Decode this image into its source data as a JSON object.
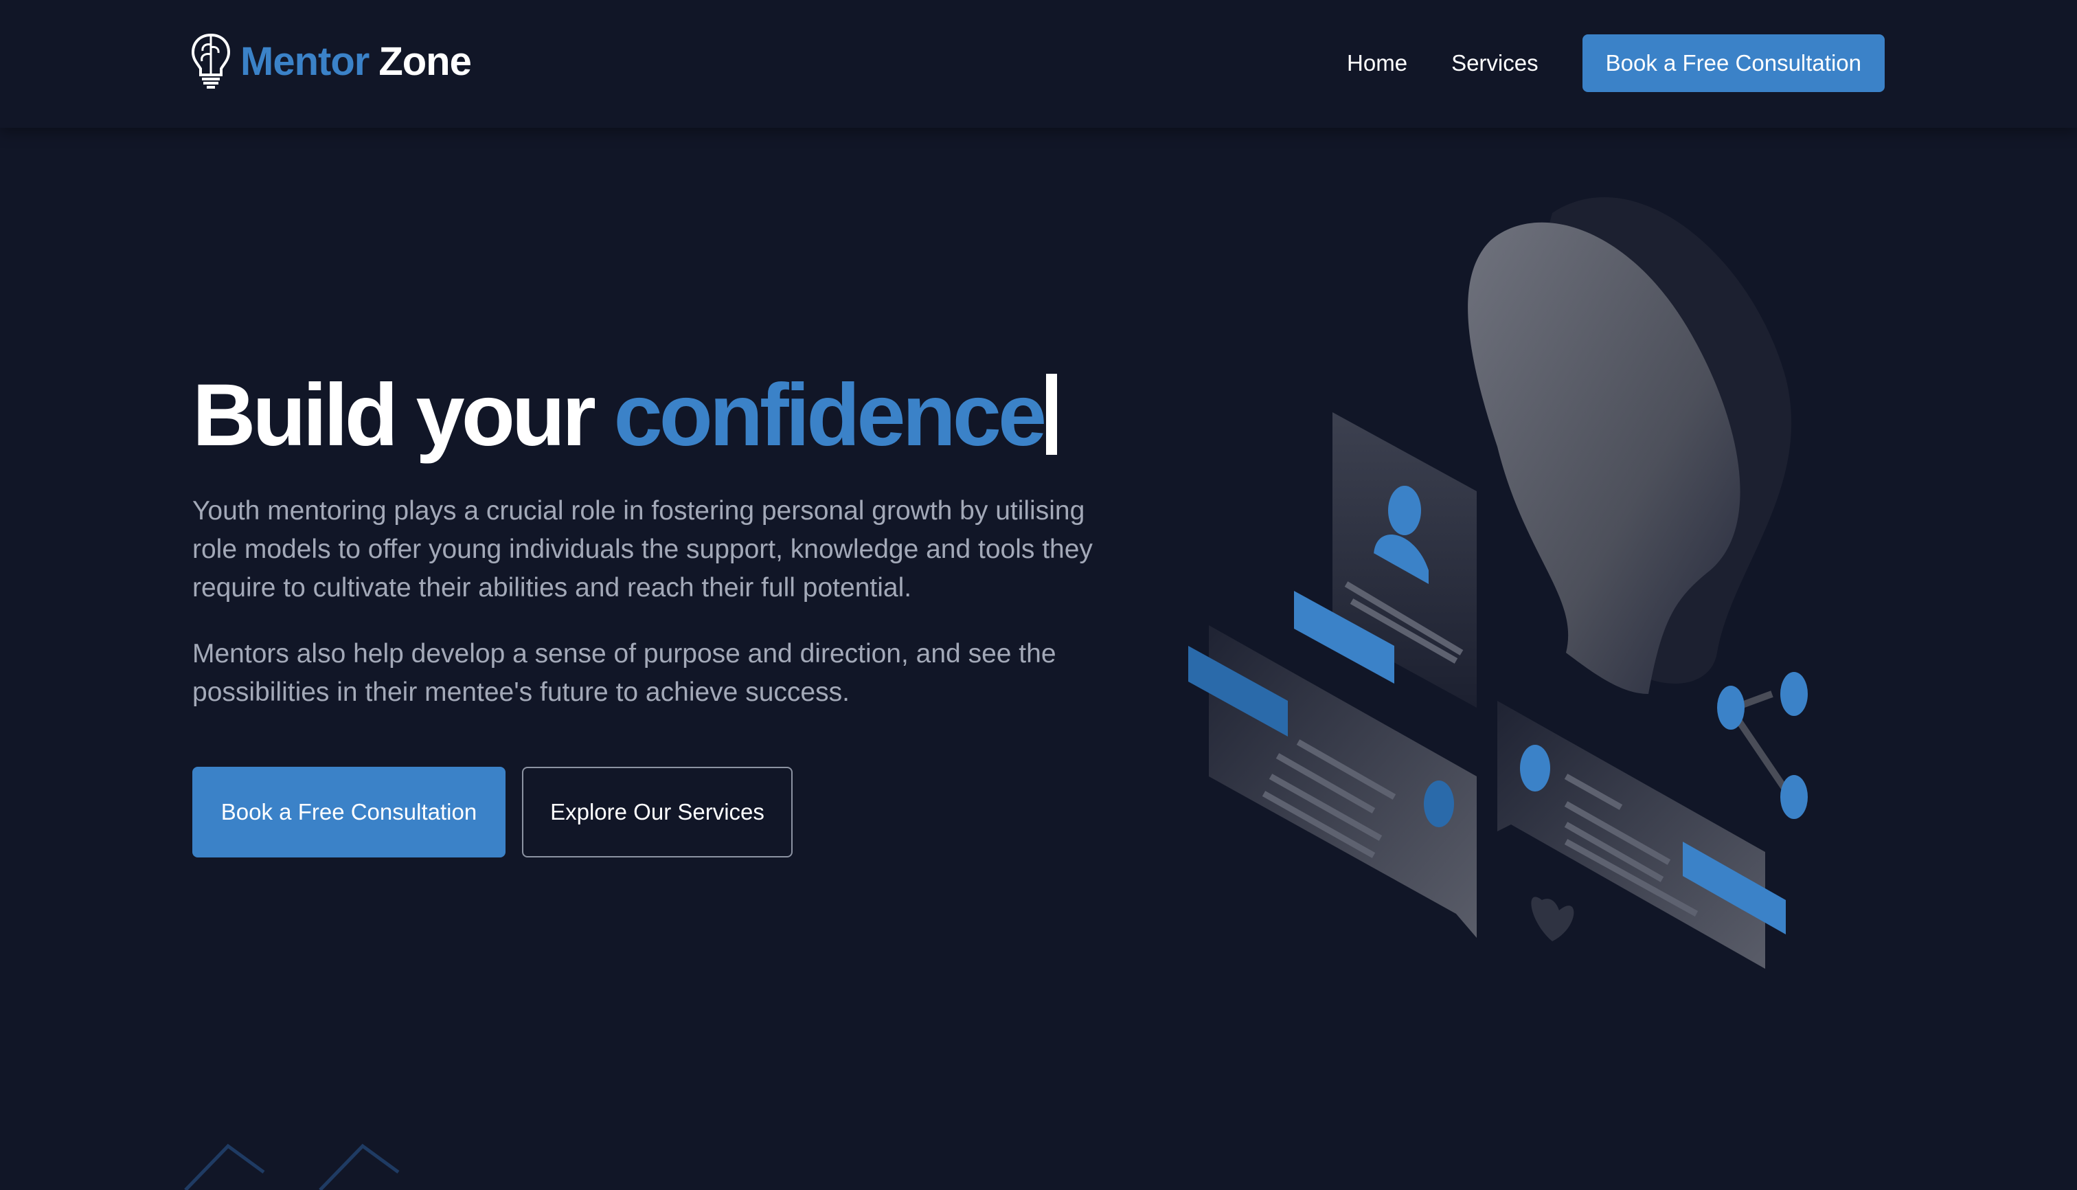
{
  "header": {
    "logo": {
      "word1": "Mentor",
      "word2": "Zone",
      "icon": "lightbulb-brain-icon"
    },
    "nav": [
      {
        "label": "Home"
      },
      {
        "label": "Services"
      }
    ],
    "cta_label": "Book a Free Consultation"
  },
  "hero": {
    "title_main": "Build your",
    "title_accent": "confidence",
    "paragraph1": "Youth mentoring plays a crucial role in fostering personal growth by utilising role models to offer young individuals the support, knowledge and tools they require to cultivate their abilities and reach their full potential.",
    "paragraph2": "Mentors also help develop a sense of purpose and direction, and see the possibilities in their mentee's future to achieve success.",
    "primary_button": "Book a Free Consultation",
    "secondary_button": "Explore Our Services",
    "illustration": "isometric-mentoring-illustration"
  },
  "colors": {
    "background": "#111627",
    "accent": "#3b82c8",
    "text": "#ffffff",
    "muted_text": "#a3a9b8"
  }
}
